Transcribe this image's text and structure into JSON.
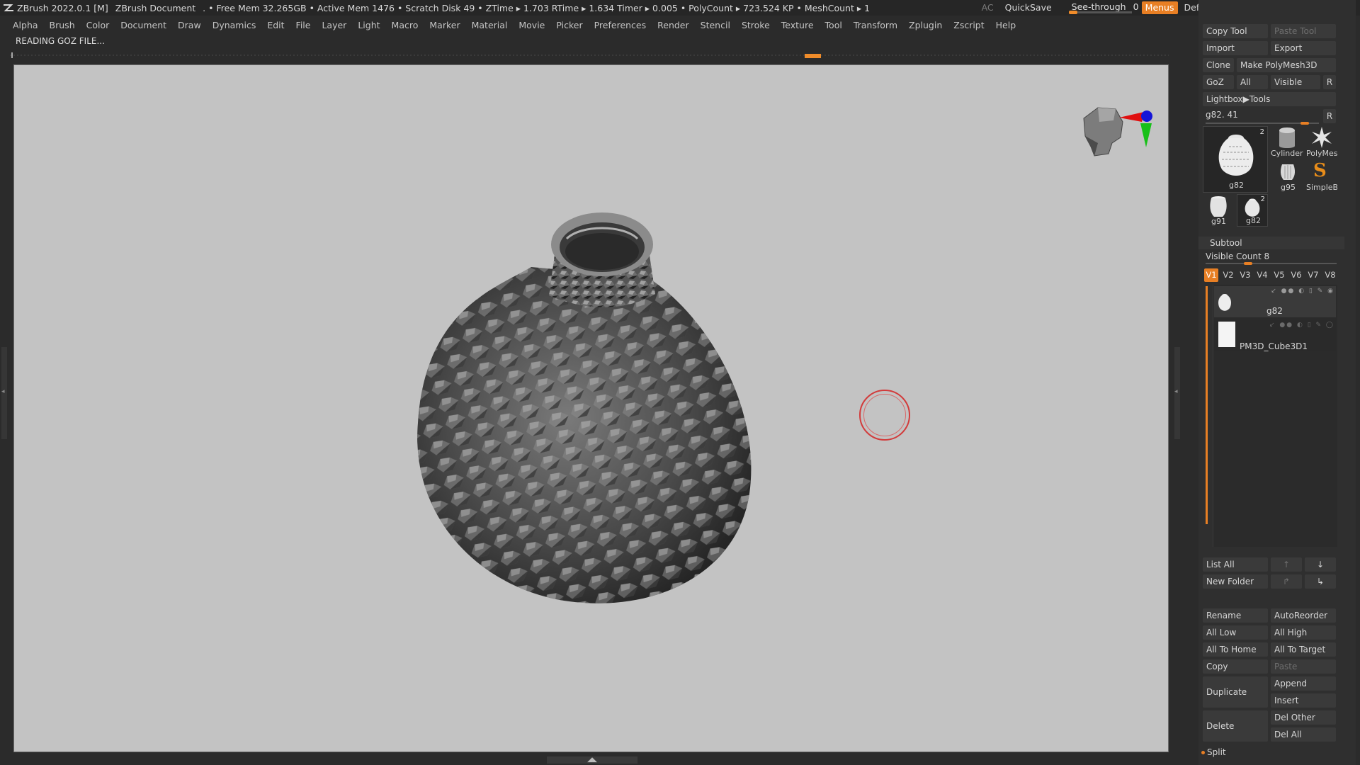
{
  "titlebar": {
    "app_title": "ZBrush 2022.0.1 [M]",
    "document": "ZBrush Document",
    "stats": ". • Free Mem 32.265GB • Active Mem 1476 • Scratch Disk 49 • ZTime ▸ 1.703 RTime ▸ 1.634 Timer ▸ 0.005 • PolyCount ▸ 723.524 KP • MeshCount ▸ 1",
    "ac": "AC",
    "quicksave": "QuickSave",
    "seethrough_label": "See-through",
    "seethrough_value": "0",
    "menus": "Menus",
    "script": "DefaultZScript"
  },
  "menubar": {
    "items": [
      "Alpha",
      "Brush",
      "Color",
      "Document",
      "Draw",
      "Dynamics",
      "Edit",
      "File",
      "Layer",
      "Light",
      "Macro",
      "Marker",
      "Material",
      "Movie",
      "Picker",
      "Preferences",
      "Render",
      "Stencil",
      "Stroke",
      "Texture",
      "Tool",
      "Transform",
      "Zplugin",
      "Zscript",
      "Help"
    ]
  },
  "status": {
    "message": "READING GOZ FILE..."
  },
  "tool_panel": {
    "copy_tool": "Copy Tool",
    "paste_tool": "Paste Tool",
    "import": "Import",
    "export": "Export",
    "clone": "Clone",
    "make_polymesh": "Make PolyMesh3D",
    "goz": "GoZ",
    "all": "All",
    "visible": "Visible",
    "r": "R",
    "lightbox_tools": "Lightbox▶Tools",
    "current_tool": "g82. 41",
    "slider_r": "R",
    "thumbs": {
      "main_label": "g82",
      "main_count": "2",
      "cylinder": "Cylinder",
      "polymesh": "PolyMes",
      "g95": "g95",
      "simpleb": "SimpleB",
      "g91": "g91",
      "g82_small": "g82",
      "g82_small_count": "2"
    }
  },
  "subtool": {
    "title": "Subtool",
    "visible_count": "Visible Count 8",
    "tabs": [
      "V1",
      "V2",
      "V3",
      "V4",
      "V5",
      "V6",
      "V7",
      "V8"
    ],
    "items": [
      {
        "name": "g82"
      },
      {
        "name": "PM3D_Cube3D1"
      }
    ],
    "list_all": "List All",
    "new_folder": "New Folder",
    "rename": "Rename",
    "autoreorder": "AutoReorder",
    "all_low": "All Low",
    "all_high": "All High",
    "all_to_home": "All To Home",
    "all_to_target": "All To Target",
    "copy": "Copy",
    "paste": "Paste",
    "duplicate": "Duplicate",
    "append": "Append",
    "insert": "Insert",
    "delete": "Delete",
    "del_other": "Del Other",
    "del_all": "Del All",
    "split": "Split"
  },
  "colors": {
    "accent": "#e87f24",
    "viewport_bg": "#c3c3c3",
    "panel_bg": "#2f2f2f"
  }
}
